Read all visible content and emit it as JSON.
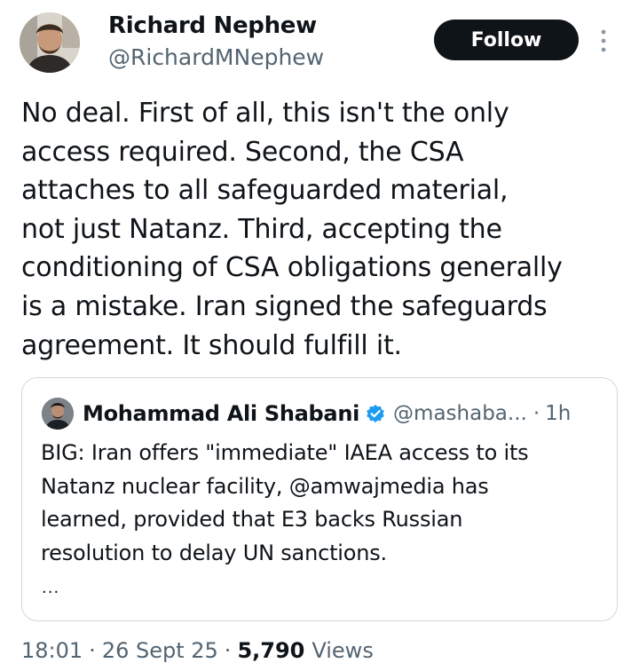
{
  "author": {
    "display_name": "Richard Nephew",
    "handle": "@RichardMNephew",
    "avatar_icon": "person-photo"
  },
  "follow_label": "Follow",
  "more_icon": "vertical-ellipsis-icon",
  "tweet_text": "No deal.  First of all, this isn't the only\naccess required.  Second, the CSA\nattaches to all safeguarded material,\nnot just Natanz.  Third, accepting the\nconditioning of CSA obligations generally\nis a mistake.  Iran signed the safeguards\nagreement.  It should fulfill it.",
  "quote": {
    "display_name": "Mohammad Ali Shabani",
    "verified_icon": "verified-badge-icon",
    "handle": "@mashaba...",
    "dot": "·",
    "time": "1h",
    "text": "BIG: Iran offers \"immediate\" IAEA access to its\nNatanz nuclear facility, @amwajmedia has\nlearned, provided that E3 backs Russian\nresolution to delay UN sanctions.",
    "ellipsis": "..."
  },
  "meta": {
    "time": "18:01",
    "sep1": "·",
    "date": "26 Sept 25",
    "sep2": "·",
    "views_count": "5,790",
    "views_label": "Views"
  },
  "colors": {
    "text_primary": "#0f1419",
    "text_secondary": "#536471",
    "border": "#cfd9de",
    "verified": "#1d9bf0",
    "follow_bg": "#0f1419",
    "follow_text": "#ffffff"
  }
}
